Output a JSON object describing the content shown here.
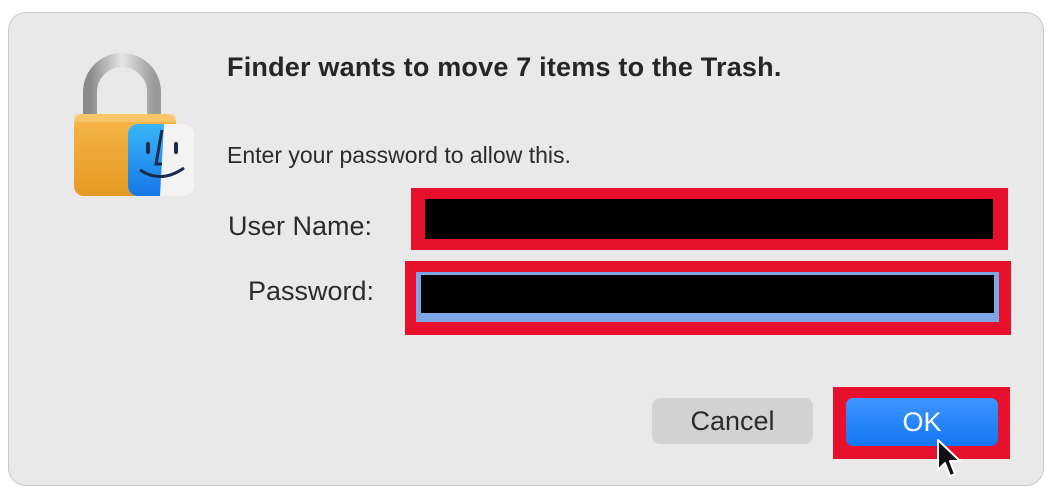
{
  "dialog": {
    "title": "Finder wants to move 7 items to the Trash.",
    "message": "Enter your password to allow this.",
    "icon": "lock-finder-icon"
  },
  "fields": {
    "user_name_label": "User Name:",
    "user_name_value": "",
    "password_label": "Password:",
    "password_value": ""
  },
  "buttons": {
    "cancel_label": "Cancel",
    "ok_label": "OK"
  },
  "colors": {
    "highlight": "#e8112d",
    "ok_button": "#1476f5",
    "focus_ring": "#7ea6e6",
    "dialog_bg": "#e9e9e9"
  }
}
